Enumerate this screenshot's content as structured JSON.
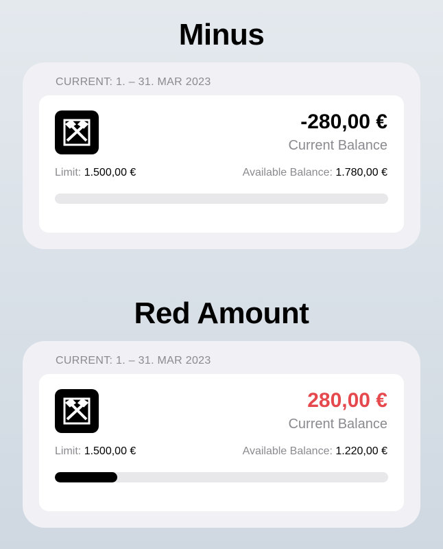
{
  "colors": {
    "negative_amount": "#000000",
    "red_amount": "#e5484d",
    "progress_fill": "#000000",
    "progress_track": "#e8e8ea"
  },
  "sections": [
    {
      "title": "Minus",
      "period": "CURRENT: 1. – 31. MAR 2023",
      "logo_icon": "bank-logo-icon",
      "amount": "-280,00 €",
      "amount_style": "black",
      "balance_caption": "Current Balance",
      "limit_label": "Limit:",
      "limit_value": "1.500,00 €",
      "available_label": "Available Balance:",
      "available_value": "1.780,00 €",
      "progress_fraction": 0
    },
    {
      "title": "Red Amount",
      "period": "CURRENT: 1. – 31. MAR 2023",
      "logo_icon": "bank-logo-icon",
      "amount": "280,00 €",
      "amount_style": "red",
      "balance_caption": "Current Balance",
      "limit_label": "Limit:",
      "limit_value": "1.500,00 €",
      "available_label": "Available Balance:",
      "available_value": "1.220,00 €",
      "progress_fraction": 0.187
    }
  ]
}
